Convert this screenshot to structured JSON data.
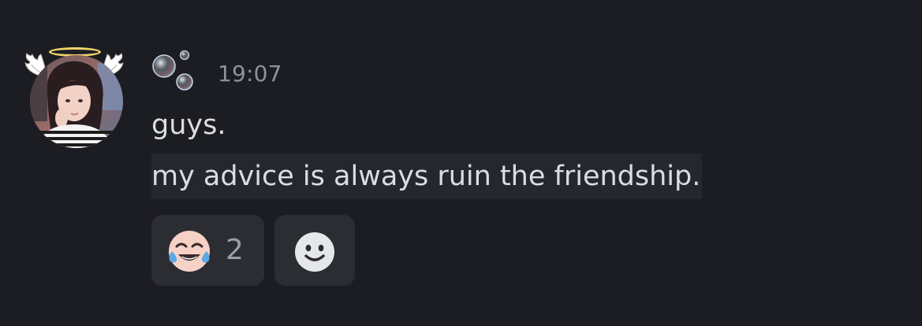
{
  "message": {
    "author_avatar": "profile-photo-with-halo-and-wings",
    "username_icon": "bubbles-icon",
    "timestamp": "19:07",
    "lines": [
      "guys.",
      "my advice is always ruin the friendship."
    ]
  },
  "reactions": [
    {
      "emoji": "tears-of-joy-icon",
      "count": "2"
    },
    {
      "emoji": "add-reaction-icon"
    }
  ],
  "colors": {
    "background": "#1c1d23",
    "text": "#dcdde1",
    "muted": "#8e9297",
    "reaction_bg": "#2b2d33",
    "highlight_bg": "#25272e"
  }
}
